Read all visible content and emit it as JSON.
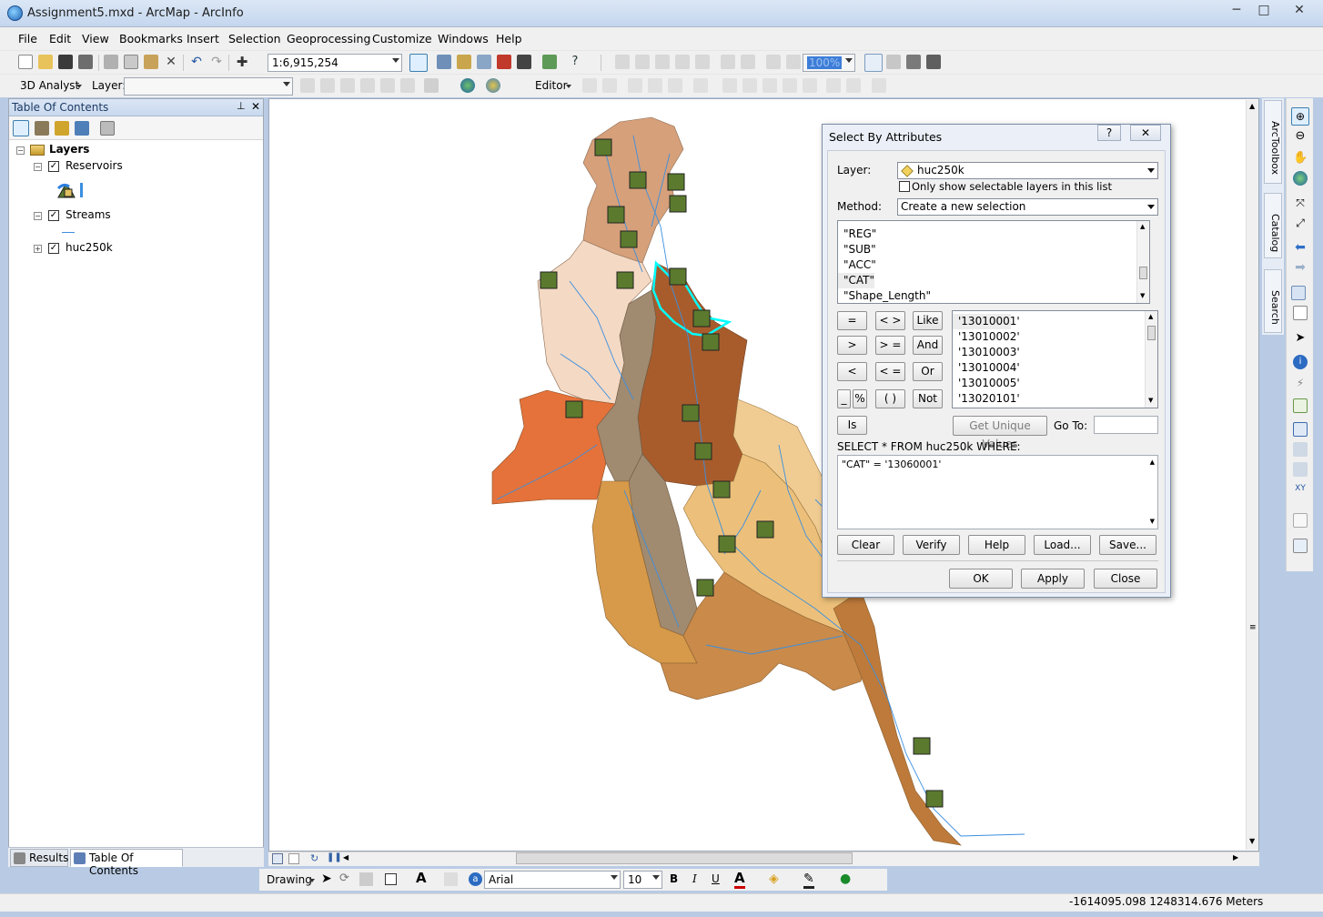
{
  "window": {
    "title": "Assignment5.mxd - ArcMap - ArcInfo",
    "min": "─",
    "max": "□",
    "close": "✕"
  },
  "menu": [
    "File",
    "Edit",
    "View",
    "Bookmarks",
    "Insert",
    "Selection",
    "Geoprocessing",
    "Customize",
    "Windows",
    "Help"
  ],
  "toolbar": {
    "scale": "1:6,915,254",
    "zoom": "100%",
    "analyst": "3D Analyst",
    "layer_label": "Layer:",
    "layer_value": "",
    "editor": "Editor"
  },
  "toc": {
    "title": "Table Of Contents",
    "pin": "📌",
    "close": "✕",
    "root": "Layers",
    "layers": [
      {
        "name": "Reservoirs",
        "checked": true
      },
      {
        "name": "Streams",
        "checked": true
      },
      {
        "name": "huc250k",
        "checked": true
      }
    ],
    "tabs": [
      "Results",
      "Table Of Contents"
    ]
  },
  "side_tabs": [
    "ArcToolbox",
    "Catalog",
    "Search"
  ],
  "dialog": {
    "title": "Select By Attributes",
    "help_btn": "?",
    "close_btn": "✕",
    "layer_label": "Layer:",
    "layer_value": "huc250k",
    "only_selectable": "Only show selectable layers in this list",
    "method_label": "Method:",
    "method_value": "Create a new selection",
    "fields": [
      "\"REG\"",
      "\"SUB\"",
      "\"ACC\"",
      "\"CAT\"",
      "\"Shape_Length\""
    ],
    "operators": [
      "=",
      "< >",
      "Like",
      ">",
      "> =",
      "And",
      "<",
      "< =",
      "Or",
      "_",
      "%",
      "( )",
      "Not",
      "Is"
    ],
    "values": [
      "'13010001'",
      "'13010002'",
      "'13010003'",
      "'13010004'",
      "'13010005'",
      "'13020101'"
    ],
    "get_unique": "Get Unique Values",
    "goto_label": "Go To:",
    "sql_label": "SELECT * FROM huc250k WHERE:",
    "expression": "\"CAT\" = '13060001'",
    "buttons": [
      "Clear",
      "Verify",
      "Help",
      "Load...",
      "Save..."
    ],
    "ok": "OK",
    "apply": "Apply",
    "close": "Close"
  },
  "drawing": {
    "label": "Drawing",
    "font": "Arial",
    "size": "10",
    "bold": "B",
    "italic": "I",
    "underline": "U"
  },
  "status": {
    "coords": "-1614095.098  1248314.676 Meters"
  },
  "colors": {
    "accent_title": "#1e3a64",
    "selection_outline": "#00ffff",
    "stream_blue": "#3b8fe0"
  }
}
